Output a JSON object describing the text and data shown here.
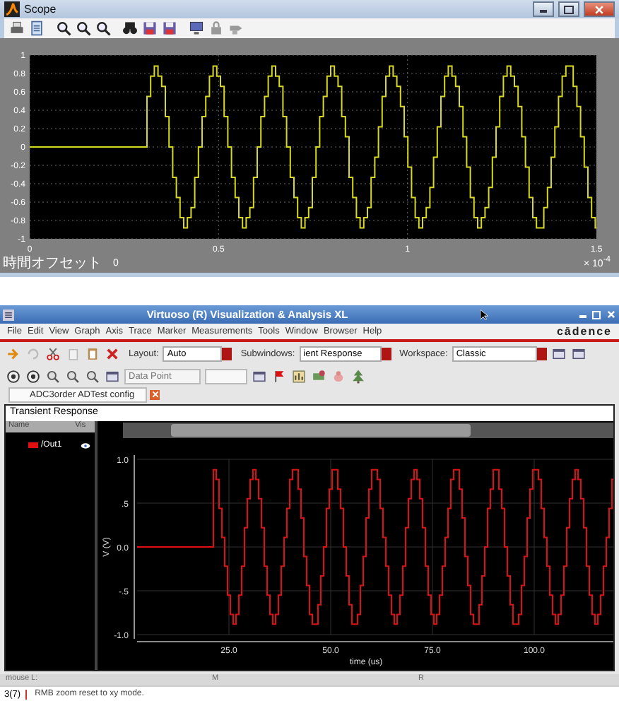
{
  "scope": {
    "title": "Scope",
    "plot": {
      "yticks": [
        "1",
        "0.8",
        "0.6",
        "0.4",
        "0.2",
        "0",
        "-0.2",
        "-0.4",
        "-0.6",
        "-0.8",
        "-1"
      ],
      "xticks": [
        "0",
        "0.5",
        "1",
        "1.5"
      ],
      "x_scale": "× 10$^{-4}$"
    },
    "offset_label": "時間オフセット",
    "offset_value": "0"
  },
  "virtuoso": {
    "title": "Virtuoso (R) Visualization & Analysis XL",
    "menus": [
      "File",
      "Edit",
      "View",
      "Graph",
      "Axis",
      "Trace",
      "Marker",
      "Measurements",
      "Tools",
      "Window",
      "Browser",
      "Help"
    ],
    "brand": "cādence",
    "layout_label": "Layout:",
    "layout_value": "Auto",
    "subwindows_label": "Subwindows:",
    "subwindows_value": "ient Response",
    "workspace_label": "Workspace:",
    "workspace_value": "Classic",
    "data_point_placeholder": "Data Point",
    "tab": "ADC3order ADTest config",
    "panel_title": "Transient Response",
    "legend": {
      "columns": [
        "Name",
        "Vis"
      ],
      "traces": [
        {
          "name": "/Out1",
          "color": "#e01010"
        }
      ]
    },
    "plot": {
      "yticks": [
        "1.0",
        ".5",
        "0.0",
        "-.5",
        "-1.0"
      ],
      "xticks": [
        "25.0",
        "50.0",
        "75.0",
        "100.0"
      ],
      "ylabel": "V (V)",
      "xlabel": "time (us)"
    },
    "status": {
      "mouse": "mouse L:",
      "middle": "M",
      "right": "R",
      "count": "3(7)",
      "message": "RMB zoom reset to xy mode."
    }
  }
}
